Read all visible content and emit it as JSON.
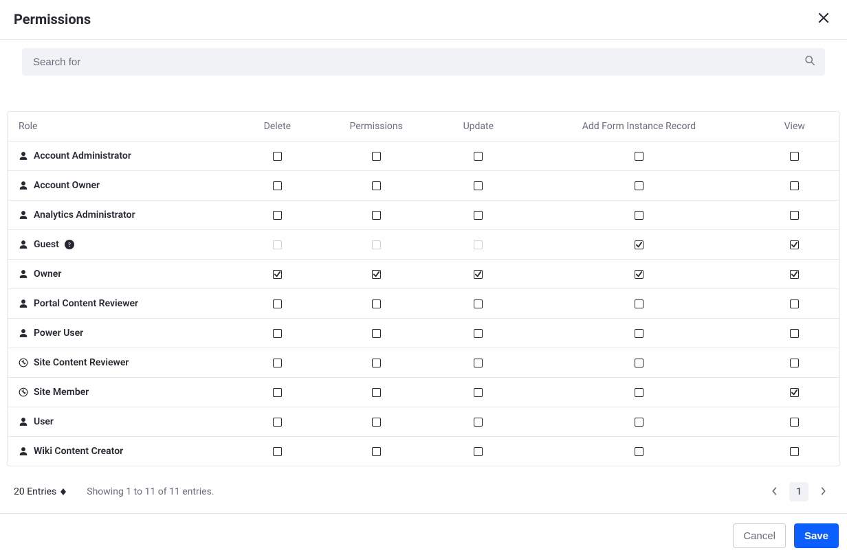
{
  "header": {
    "title": "Permissions"
  },
  "search": {
    "placeholder": "Search for"
  },
  "columns": [
    "Role",
    "Delete",
    "Permissions",
    "Update",
    "Add Form Instance Record",
    "View"
  ],
  "roles": [
    {
      "name": "Account Administrator",
      "icon": "user",
      "help": false,
      "perms": {
        "Delete": {
          "c": false,
          "d": false
        },
        "Permissions": {
          "c": false,
          "d": false
        },
        "Update": {
          "c": false,
          "d": false
        },
        "Add Form Instance Record": {
          "c": false,
          "d": false
        },
        "View": {
          "c": false,
          "d": false
        }
      }
    },
    {
      "name": "Account Owner",
      "icon": "user",
      "help": false,
      "perms": {
        "Delete": {
          "c": false,
          "d": false
        },
        "Permissions": {
          "c": false,
          "d": false
        },
        "Update": {
          "c": false,
          "d": false
        },
        "Add Form Instance Record": {
          "c": false,
          "d": false
        },
        "View": {
          "c": false,
          "d": false
        }
      }
    },
    {
      "name": "Analytics Administrator",
      "icon": "user",
      "help": false,
      "perms": {
        "Delete": {
          "c": false,
          "d": false
        },
        "Permissions": {
          "c": false,
          "d": false
        },
        "Update": {
          "c": false,
          "d": false
        },
        "Add Form Instance Record": {
          "c": false,
          "d": false
        },
        "View": {
          "c": false,
          "d": false
        }
      }
    },
    {
      "name": "Guest",
      "icon": "user",
      "help": true,
      "perms": {
        "Delete": {
          "c": false,
          "d": true
        },
        "Permissions": {
          "c": false,
          "d": true
        },
        "Update": {
          "c": false,
          "d": true
        },
        "Add Form Instance Record": {
          "c": true,
          "d": false
        },
        "View": {
          "c": true,
          "d": false
        }
      }
    },
    {
      "name": "Owner",
      "icon": "user",
      "help": false,
      "perms": {
        "Delete": {
          "c": true,
          "d": false
        },
        "Permissions": {
          "c": true,
          "d": false
        },
        "Update": {
          "c": true,
          "d": false
        },
        "Add Form Instance Record": {
          "c": true,
          "d": false
        },
        "View": {
          "c": true,
          "d": false
        }
      }
    },
    {
      "name": "Portal Content Reviewer",
      "icon": "user",
      "help": false,
      "perms": {
        "Delete": {
          "c": false,
          "d": false
        },
        "Permissions": {
          "c": false,
          "d": false
        },
        "Update": {
          "c": false,
          "d": false
        },
        "Add Form Instance Record": {
          "c": false,
          "d": false
        },
        "View": {
          "c": false,
          "d": false
        }
      }
    },
    {
      "name": "Power User",
      "icon": "user",
      "help": false,
      "perms": {
        "Delete": {
          "c": false,
          "d": false
        },
        "Permissions": {
          "c": false,
          "d": false
        },
        "Update": {
          "c": false,
          "d": false
        },
        "Add Form Instance Record": {
          "c": false,
          "d": false
        },
        "View": {
          "c": false,
          "d": false
        }
      }
    },
    {
      "name": "Site Content Reviewer",
      "icon": "site",
      "help": false,
      "perms": {
        "Delete": {
          "c": false,
          "d": false
        },
        "Permissions": {
          "c": false,
          "d": false
        },
        "Update": {
          "c": false,
          "d": false
        },
        "Add Form Instance Record": {
          "c": false,
          "d": false
        },
        "View": {
          "c": false,
          "d": false
        }
      }
    },
    {
      "name": "Site Member",
      "icon": "site",
      "help": false,
      "perms": {
        "Delete": {
          "c": false,
          "d": false
        },
        "Permissions": {
          "c": false,
          "d": false
        },
        "Update": {
          "c": false,
          "d": false
        },
        "Add Form Instance Record": {
          "c": false,
          "d": false
        },
        "View": {
          "c": true,
          "d": false
        }
      }
    },
    {
      "name": "User",
      "icon": "user",
      "help": false,
      "perms": {
        "Delete": {
          "c": false,
          "d": false
        },
        "Permissions": {
          "c": false,
          "d": false
        },
        "Update": {
          "c": false,
          "d": false
        },
        "Add Form Instance Record": {
          "c": false,
          "d": false
        },
        "View": {
          "c": false,
          "d": false
        }
      }
    },
    {
      "name": "Wiki Content Creator",
      "icon": "user",
      "help": false,
      "perms": {
        "Delete": {
          "c": false,
          "d": false
        },
        "Permissions": {
          "c": false,
          "d": false
        },
        "Update": {
          "c": false,
          "d": false
        },
        "Add Form Instance Record": {
          "c": false,
          "d": false
        },
        "View": {
          "c": false,
          "d": false
        }
      }
    }
  ],
  "footer": {
    "entries_label": "20 Entries",
    "showing": "Showing 1 to 11 of 11 entries.",
    "page": "1"
  },
  "buttons": {
    "cancel": "Cancel",
    "save": "Save"
  }
}
